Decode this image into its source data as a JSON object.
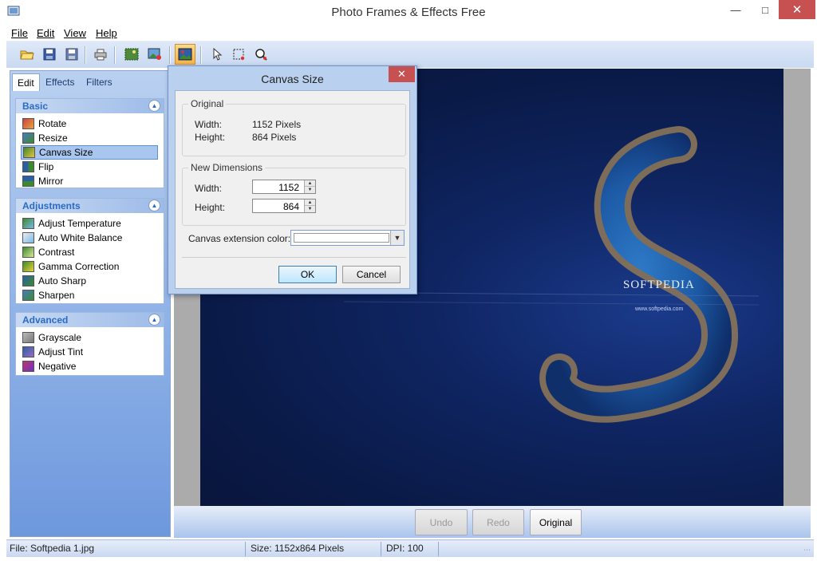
{
  "window": {
    "title": "Photo Frames & Effects Free"
  },
  "menu": {
    "items": [
      "File",
      "Edit",
      "View",
      "Help"
    ]
  },
  "panel": {
    "tabs": [
      "Edit",
      "Effects",
      "Filters"
    ],
    "sections": [
      {
        "title": "Basic",
        "items": [
          "Rotate",
          "Resize",
          "Canvas Size",
          "Flip",
          "Mirror"
        ],
        "selected": "Canvas Size"
      },
      {
        "title": "Adjustments",
        "items": [
          "Adjust Temperature",
          "Auto White Balance",
          "Contrast",
          "Gamma Correction",
          "Auto Sharp",
          "Sharpen"
        ]
      },
      {
        "title": "Advanced",
        "items": [
          "Grayscale",
          "Adjust Tint",
          "Negative"
        ]
      }
    ]
  },
  "photo": {
    "brand_text": "SOFTPEDIA",
    "url_text": "www.softpedia.com"
  },
  "actions": {
    "undo": "Undo",
    "redo": "Redo",
    "original": "Original"
  },
  "status": {
    "file": "File: Softpedia 1.jpg",
    "size": "Size: 1152x864 Pixels",
    "dpi": "DPI: 100"
  },
  "dialog": {
    "title": "Canvas Size",
    "original_legend": "Original",
    "width_label": "Width:",
    "height_label": "Height:",
    "original_width": "1152 Pixels",
    "original_height": "864 Pixels",
    "new_legend": "New Dimensions",
    "new_width": "1152",
    "new_height": "864",
    "ext_color_label": "Canvas extension color:",
    "ok": "OK",
    "cancel": "Cancel"
  },
  "colors": {
    "accent": "#2a6bc6",
    "close": "#c75050",
    "panel": "#8aaee6"
  }
}
